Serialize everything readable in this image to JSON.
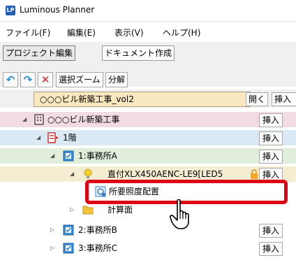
{
  "app": {
    "title": "Luminous Planner",
    "icon_text": "LP"
  },
  "menu": [
    "ファイル(F)",
    "編集(E)",
    "表示(V)",
    "ヘルプ(H)"
  ],
  "tabs": [
    "プロジェクト編集",
    "ドキュメント作成"
  ],
  "toolbar": {
    "zoom_label": "選択ズーム",
    "split_label": "分解"
  },
  "file": {
    "name": "○○○ビル新築工事_vol2",
    "open_label": "開く",
    "insert_label": "挿入"
  },
  "tree": {
    "insert_label": "挿入",
    "building": "○○○ビル新築工事",
    "floor": "1階",
    "room_a": "1:事務所A",
    "fixture": "直付XLX450AENC-LE9[LED5",
    "required_illum": "所要照度配置",
    "calc_plane": "計算面",
    "room_b": "2:事務所B",
    "room_c": "3:事務所C"
  },
  "colors": {
    "building_bg": "#f3dbe6",
    "floor_bg": "#dbe9f5",
    "room_bg": "#e1eedb",
    "fixture_bg": "#f5edd1",
    "highlight": "#e00014"
  }
}
